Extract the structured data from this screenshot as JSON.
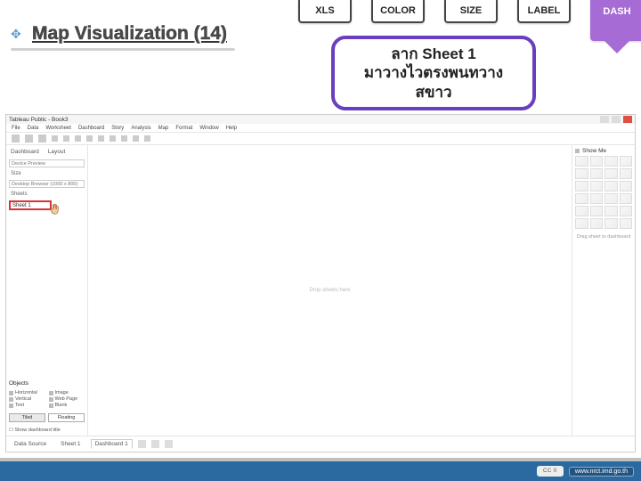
{
  "slide": {
    "title": "Map Visualization (14)",
    "tabs": {
      "xls": "XLS",
      "color": "COLOR",
      "size": "SIZE",
      "label": "LABEL",
      "dash": "DASH"
    },
    "instruction": {
      "line1": "ลาก Sheet 1",
      "line2": "มาวางไวตรงพนทวาง",
      "line3": "สขาว"
    }
  },
  "tableau": {
    "window_title": "Tableau Public - Book3",
    "menu": [
      "File",
      "Data",
      "Worksheet",
      "Dashboard",
      "Story",
      "Analysis",
      "Map",
      "Format",
      "Window",
      "Help"
    ],
    "left": {
      "tabs": [
        "Dashboard",
        "Layout"
      ],
      "device_preview": "Device Preview",
      "size_label": "Size",
      "size_value": "Desktop Browser (1000 x 800)",
      "sheets_label": "Sheets",
      "sheet_item": "Sheet 1",
      "objects_label": "Objects",
      "objects": [
        "Horizontal",
        "Image",
        "Vertical",
        "Web Page",
        "Text",
        "Blank"
      ],
      "layout_buttons": [
        "Tiled",
        "Floating"
      ],
      "checkbox": "Show dashboard title"
    },
    "canvas_hint": "Drop sheets here",
    "right": {
      "header": "Show Me",
      "drag_msg": "Drag sheet to dashboard"
    },
    "footer": {
      "data_source": "Data Source",
      "sheet1": "Sheet 1",
      "dash1": "Dashboard 1"
    }
  },
  "bottom": {
    "cc": "CC 0",
    "url": "www.nrct.imd.go.th"
  }
}
